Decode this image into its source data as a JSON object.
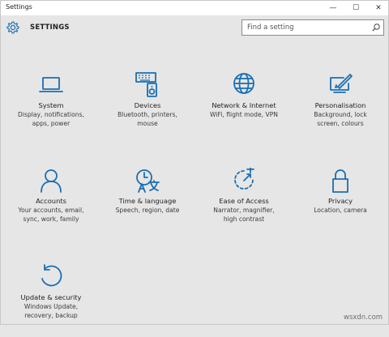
{
  "window": {
    "title": "Settings",
    "controls": {
      "minimize": "—",
      "maximize": "☐",
      "close": "✕"
    }
  },
  "header": {
    "icon": "gear-icon",
    "title": "SETTINGS"
  },
  "search": {
    "placeholder": "Find a setting",
    "icon": "search-icon"
  },
  "accent_color": "#1a6fb3",
  "tiles": [
    {
      "icon": "laptop-icon",
      "label": "System",
      "description": "Display, notifications,\napps, power"
    },
    {
      "icon": "keyboard-speaker-icon",
      "label": "Devices",
      "description": "Bluetooth, printers,\nmouse"
    },
    {
      "icon": "globe-icon",
      "label": "Network & Internet",
      "description": "WiFi, flight mode, VPN"
    },
    {
      "icon": "paintbrush-screen-icon",
      "label": "Personalisation",
      "description": "Background, lock\nscreen, colours"
    },
    {
      "icon": "person-icon",
      "label": "Accounts",
      "description": "Your accounts, email,\nsync, work, family"
    },
    {
      "icon": "clock-language-icon",
      "label": "Time & language",
      "description": "Speech, region, date"
    },
    {
      "icon": "ease-of-access-icon",
      "label": "Ease of Access",
      "description": "Narrator, magnifier,\nhigh contrast"
    },
    {
      "icon": "lock-icon",
      "label": "Privacy",
      "description": "Location, camera"
    },
    {
      "icon": "update-icon",
      "label": "Update & security",
      "description": "Windows Update,\nrecovery, backup"
    }
  ],
  "watermark": "wsxdn.com"
}
